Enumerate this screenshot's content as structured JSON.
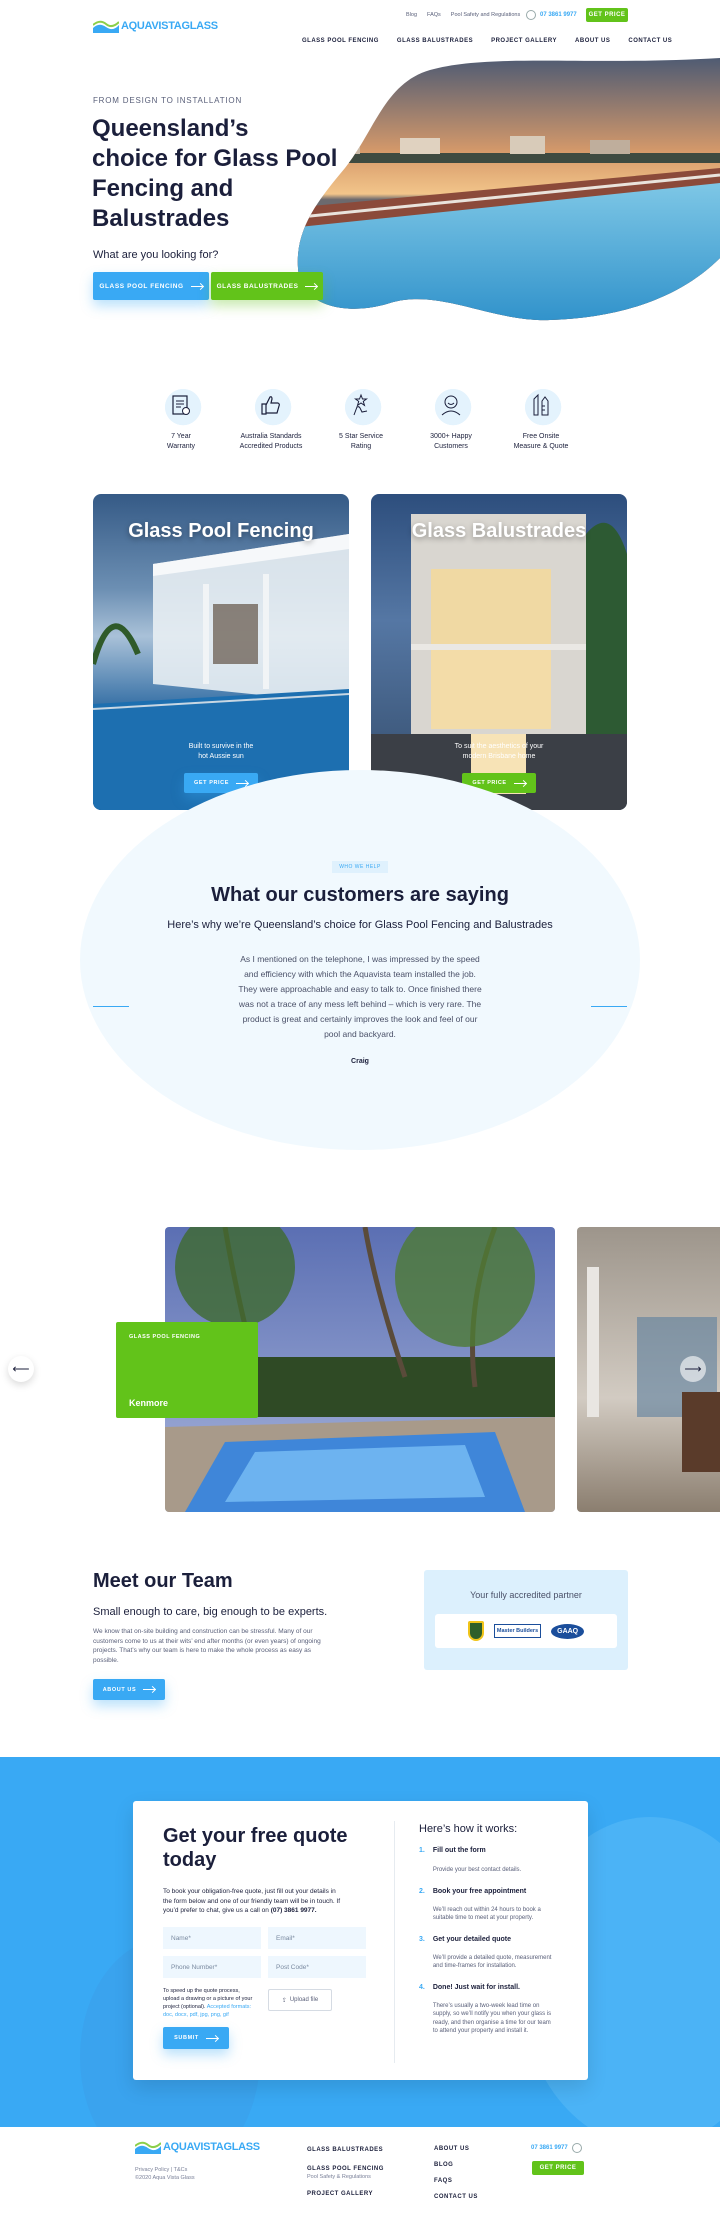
{
  "header": {
    "logo_text": "AQUAVISTAGLASS",
    "top_links": [
      "Blog",
      "FAQs",
      "Pool Safety and Regulations"
    ],
    "phone": "07 3861 9977",
    "get_price": "GET PRICE",
    "nav": [
      "GLASS POOL FENCING",
      "GLASS BALUSTRADES",
      "PROJECT GALLERY",
      "ABOUT US",
      "CONTACT US"
    ]
  },
  "hero": {
    "eyebrow": "FROM DESIGN TO INSTALLATION",
    "title_lines": [
      "Queensland’s",
      "choice for Glass Pool",
      "Fencing and",
      "Balustrades"
    ],
    "question": "What are you looking for?",
    "btn_fencing": "GLASS POOL FENCING",
    "btn_balustrades": "GLASS BALUSTRADES"
  },
  "features": [
    {
      "icon": "certificate-icon",
      "line1": "7 Year",
      "line2": "Warranty"
    },
    {
      "icon": "thumbs-up-icon",
      "line1": "Australia Standards",
      "line2": "Accredited Products"
    },
    {
      "icon": "star-hand-icon",
      "line1": "5 Star Service",
      "line2": "Rating"
    },
    {
      "icon": "happy-customers-icon",
      "line1": "3000+ Happy",
      "line2": "Customers"
    },
    {
      "icon": "measure-tools-icon",
      "line1": "Free Onsite",
      "line2": "Measure & Quote"
    }
  ],
  "cards": [
    {
      "title": "Glass Pool Fencing",
      "cap1": "Built to survive in the",
      "cap2": "hot Aussie sun",
      "btn": "GET PRICE"
    },
    {
      "title": "Glass Balustrades",
      "cap1": "To suit the aesthetics of your",
      "cap2": "modern Brisbane home",
      "btn": "GET PRICE"
    }
  ],
  "testimonials": {
    "tag": "WHO WE HELP",
    "title": "What our customers are saying",
    "subtitle": "Here’s why we’re Queensland’s choice for Glass Pool Fencing and Balustrades",
    "quote_lines": [
      "As I mentioned on the telephone, I was impressed by the speed",
      "and efficiency with which the Aquavista team installed the job.",
      "They were approachable and easy to talk to. Once finished there",
      "was not a trace of any mess left behind – which is very rare. The",
      "product is great and certainly improves the look and feel of our",
      "pool and backyard."
    ],
    "author": "Craig"
  },
  "gallery": {
    "tag": "GLASS POOL FENCING",
    "location": "Kenmore"
  },
  "team": {
    "title": "Meet our Team",
    "subtitle": "Small enough to care, big enough to be experts.",
    "body_lines": [
      "We know that on-site building and construction can be stressful. Many of our",
      "customers come to us at their wits’ end after months (or even years) of ongoing",
      "projects. That’s why our team is here to make the whole process as easy as",
      "possible."
    ],
    "btn": "ABOUT US",
    "partner_title": "Your fully accredited partner",
    "partner_logos": [
      "Master Builders",
      "GAAQ"
    ]
  },
  "quote": {
    "title_lines": [
      "Get your free quote",
      "today"
    ],
    "intro_lines": [
      "To book your obligation-free quote, just fill out your details in",
      "the form below and one of our friendly team will be in touch. If",
      "you’d prefer to chat, give us a call on"
    ],
    "intro_phone": "(07) 3861 9977.",
    "placeholders": [
      "Name*",
      "Email*",
      "Phone Number*",
      "Post Code*"
    ],
    "upload_lines": [
      "To speed up the quote process,",
      "upload a drawing or a picture of your",
      "project (optional)."
    ],
    "upload_types_lines": [
      "Accepted formats:",
      "doc, docx, pdf, jpg, png, gif"
    ],
    "upload_btn": "Upload file",
    "submit": "SUBMIT",
    "how_title": "Here’s how it works:",
    "steps": [
      {
        "n": "1.",
        "t": "Fill out the form",
        "d": [
          "Provide your best contact details."
        ]
      },
      {
        "n": "2.",
        "t": "Book your free appointment",
        "d": [
          "We’ll reach out within 24 hours to book a",
          "suitable time to meet at your property."
        ]
      },
      {
        "n": "3.",
        "t": "Get your detailed quote",
        "d": [
          "We’ll provide a detailed quote, measurement",
          "and time-frames for installation."
        ]
      },
      {
        "n": "4.",
        "t": "Done! Just wait for install.",
        "d": [
          "There’s usually a two-week lead time on",
          "supply, so we’ll notify you when your glass is",
          "ready, and then organise a time for our team",
          "to attend your property and install it."
        ]
      }
    ]
  },
  "footer": {
    "logo_text": "AQUAVISTAGLASS",
    "legal": "Privacy Policy | T&Cs",
    "copyright": "©2020 Aqua Vista Glass",
    "col1": [
      "GLASS BALUSTRADES",
      "GLASS POOL FENCING",
      "Pool Safety & Regulations",
      "PROJECT GALLERY"
    ],
    "col2": [
      "ABOUT US",
      "BLOG",
      "FAQS",
      "CONTACT US"
    ],
    "phone": "07 3861 9977",
    "get_price": "GET PRICE"
  },
  "colors": {
    "blue": "#39a9f4",
    "green": "#62c31a",
    "navy": "#1b1f3b"
  }
}
